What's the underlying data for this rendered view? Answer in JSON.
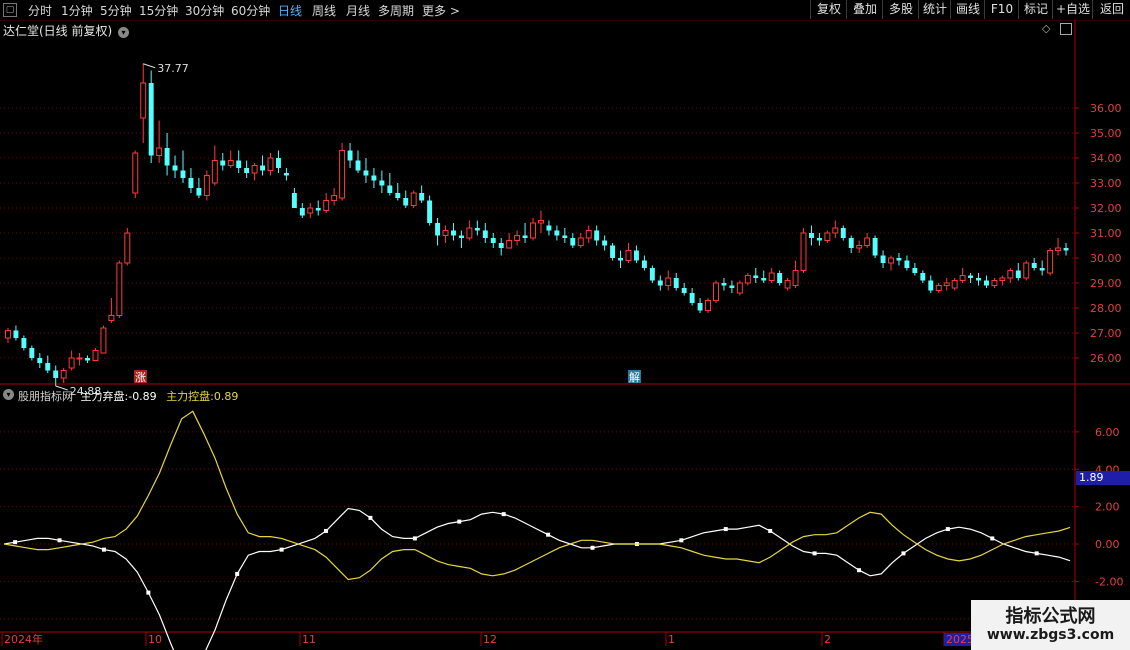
{
  "toolbar": {
    "periods": [
      "分时",
      "1分钟",
      "5分钟",
      "15分钟",
      "30分钟",
      "60分钟",
      "日线",
      "周线",
      "月线",
      "多周期",
      "更多 >"
    ],
    "active_period": "日线",
    "buttons": [
      "复权",
      "叠加",
      "多股",
      "统计",
      "画线",
      "F10",
      "标记",
      "+自选",
      "返回"
    ]
  },
  "stock": {
    "title": "达仁堂(日线 前复权)"
  },
  "indicator": {
    "name": "股朋指标网",
    "line1_label": "主力弃盘:",
    "line1_value": "-0.89",
    "line2_label": "主力控盘:",
    "line2_value": "0.89",
    "current_marker": "1.89"
  },
  "watermark": {
    "line1": "指标公式网",
    "line2": "www.zbgs3.com"
  },
  "colors": {
    "up": "#ff3a3a",
    "down": "#54ffff",
    "qipan": "#ffffff",
    "kongpan": "#e5d640",
    "grid": "#7a0000",
    "axis": "#b00000"
  },
  "chart_data": [
    {
      "type": "candlestick",
      "title": "达仁堂(日线 前复权)",
      "ylim": [
        25.0,
        38.8
      ],
      "y_ticks": [
        "36.00",
        "35.00",
        "34.00",
        "33.00",
        "32.00",
        "31.00",
        "30.00",
        "29.00",
        "28.00",
        "27.00",
        "26.00"
      ],
      "annotations": {
        "high": "37.77",
        "low": "24.88"
      },
      "markers": [
        "涨",
        "解"
      ],
      "ohlc": [
        [
          26.8,
          27.2,
          26.6,
          27.1
        ],
        [
          27.1,
          27.3,
          26.7,
          26.8
        ],
        [
          26.8,
          26.9,
          26.3,
          26.4
        ],
        [
          26.4,
          26.5,
          25.9,
          26.0
        ],
        [
          26.0,
          26.2,
          25.6,
          25.8
        ],
        [
          25.8,
          26.1,
          25.4,
          25.5
        ],
        [
          25.5,
          25.7,
          24.88,
          25.2
        ],
        [
          25.2,
          25.6,
          25.0,
          25.5
        ],
        [
          25.6,
          26.3,
          25.5,
          26.0
        ],
        [
          26.0,
          26.2,
          25.7,
          26.0
        ],
        [
          26.0,
          26.1,
          25.8,
          25.9
        ],
        [
          25.9,
          26.4,
          25.9,
          26.3
        ],
        [
          26.2,
          27.3,
          26.2,
          27.2
        ],
        [
          27.5,
          28.4,
          27.4,
          27.7
        ],
        [
          27.7,
          29.9,
          27.6,
          29.8
        ],
        [
          29.8,
          31.2,
          29.7,
          31.0
        ],
        [
          32.6,
          34.3,
          32.4,
          34.2
        ],
        [
          35.6,
          37.77,
          34.6,
          37.0
        ],
        [
          37.0,
          37.5,
          33.8,
          34.1
        ],
        [
          34.1,
          35.5,
          33.8,
          34.4
        ],
        [
          34.4,
          35.0,
          33.3,
          33.7
        ],
        [
          33.7,
          34.1,
          33.2,
          33.5
        ],
        [
          33.5,
          34.3,
          33.0,
          33.2
        ],
        [
          33.2,
          33.6,
          32.6,
          32.8
        ],
        [
          32.8,
          33.2,
          32.4,
          32.5
        ],
        [
          32.5,
          33.5,
          32.3,
          33.3
        ],
        [
          33.0,
          34.5,
          32.9,
          33.9
        ],
        [
          33.9,
          34.2,
          33.5,
          33.7
        ],
        [
          33.7,
          34.3,
          33.6,
          33.9
        ],
        [
          33.9,
          34.3,
          33.4,
          33.6
        ],
        [
          33.6,
          33.9,
          33.2,
          33.4
        ],
        [
          33.4,
          33.8,
          33.1,
          33.7
        ],
        [
          33.7,
          34.1,
          33.3,
          33.5
        ],
        [
          33.5,
          34.2,
          33.3,
          34.0
        ],
        [
          34.0,
          34.3,
          33.4,
          33.6
        ],
        [
          33.4,
          33.6,
          33.1,
          33.3
        ],
        [
          32.6,
          32.8,
          32.0,
          32.0
        ],
        [
          32.0,
          32.2,
          31.6,
          31.7
        ],
        [
          31.8,
          32.2,
          31.6,
          32.0
        ],
        [
          32.0,
          32.3,
          31.7,
          31.9
        ],
        [
          31.9,
          32.6,
          31.8,
          32.3
        ],
        [
          32.3,
          32.8,
          32.1,
          32.5
        ],
        [
          32.4,
          34.6,
          32.3,
          34.3
        ],
        [
          34.3,
          34.6,
          33.6,
          33.9
        ],
        [
          33.9,
          34.3,
          33.4,
          33.5
        ],
        [
          33.5,
          34.0,
          33.0,
          33.3
        ],
        [
          33.3,
          33.6,
          32.8,
          33.1
        ],
        [
          33.1,
          33.5,
          32.6,
          32.9
        ],
        [
          32.9,
          33.4,
          32.5,
          32.6
        ],
        [
          32.6,
          33.0,
          32.3,
          32.4
        ],
        [
          32.4,
          32.7,
          32.0,
          32.1
        ],
        [
          32.1,
          32.7,
          32.0,
          32.6
        ],
        [
          32.6,
          32.9,
          32.2,
          32.3
        ],
        [
          32.3,
          32.5,
          31.3,
          31.4
        ],
        [
          31.4,
          31.6,
          30.5,
          30.9
        ],
        [
          30.9,
          31.3,
          30.6,
          31.1
        ],
        [
          31.1,
          31.4,
          30.7,
          30.9
        ],
        [
          30.9,
          31.1,
          30.4,
          30.8
        ],
        [
          30.8,
          31.5,
          30.7,
          31.2
        ],
        [
          31.2,
          31.5,
          30.9,
          31.1
        ],
        [
          31.1,
          31.4,
          30.6,
          30.8
        ],
        [
          30.8,
          31.0,
          30.4,
          30.6
        ],
        [
          30.6,
          30.8,
          30.1,
          30.4
        ],
        [
          30.4,
          31.0,
          30.4,
          30.7
        ],
        [
          30.7,
          31.1,
          30.5,
          30.9
        ],
        [
          30.9,
          31.4,
          30.6,
          30.8
        ],
        [
          30.8,
          31.6,
          30.7,
          31.4
        ],
        [
          31.4,
          31.9,
          31.0,
          31.5
        ],
        [
          31.3,
          31.5,
          30.9,
          31.1
        ],
        [
          31.1,
          31.3,
          30.7,
          30.9
        ],
        [
          30.9,
          31.2,
          30.6,
          30.8
        ],
        [
          30.8,
          31.0,
          30.4,
          30.5
        ],
        [
          30.5,
          31.0,
          30.4,
          30.8
        ],
        [
          30.8,
          31.3,
          30.6,
          31.1
        ],
        [
          31.1,
          31.3,
          30.5,
          30.7
        ],
        [
          30.7,
          30.9,
          30.3,
          30.5
        ],
        [
          30.5,
          30.6,
          29.9,
          30.0
        ],
        [
          30.0,
          30.3,
          29.6,
          29.9
        ],
        [
          29.9,
          30.6,
          29.8,
          30.3
        ],
        [
          30.3,
          30.5,
          29.8,
          29.9
        ],
        [
          29.9,
          30.1,
          29.5,
          29.6
        ],
        [
          29.6,
          29.7,
          29.0,
          29.1
        ],
        [
          29.1,
          29.3,
          28.7,
          28.9
        ],
        [
          28.9,
          29.5,
          28.7,
          29.2
        ],
        [
          29.2,
          29.4,
          28.7,
          28.8
        ],
        [
          28.8,
          29.0,
          28.5,
          28.6
        ],
        [
          28.6,
          28.8,
          28.1,
          28.2
        ],
        [
          28.2,
          28.4,
          27.8,
          27.9
        ],
        [
          27.9,
          28.4,
          27.8,
          28.3
        ],
        [
          28.3,
          29.1,
          28.2,
          29.0
        ],
        [
          29.0,
          29.2,
          28.7,
          28.9
        ],
        [
          28.9,
          29.1,
          28.6,
          28.8
        ],
        [
          28.6,
          29.1,
          28.5,
          29.0
        ],
        [
          29.0,
          29.4,
          28.9,
          29.3
        ],
        [
          29.3,
          29.6,
          29.0,
          29.2
        ],
        [
          29.2,
          29.5,
          29.0,
          29.1
        ],
        [
          29.1,
          29.6,
          29.0,
          29.4
        ],
        [
          29.4,
          29.5,
          28.9,
          29.0
        ],
        [
          28.8,
          29.2,
          28.7,
          29.1
        ],
        [
          28.9,
          29.9,
          28.8,
          29.5
        ],
        [
          29.5,
          31.2,
          29.4,
          31.0
        ],
        [
          31.0,
          31.3,
          30.5,
          30.8
        ],
        [
          30.8,
          31.0,
          30.5,
          30.7
        ],
        [
          30.7,
          31.1,
          30.6,
          31.0
        ],
        [
          31.0,
          31.5,
          30.8,
          31.2
        ],
        [
          31.2,
          31.3,
          30.7,
          30.8
        ],
        [
          30.8,
          30.9,
          30.2,
          30.4
        ],
        [
          30.4,
          30.7,
          30.2,
          30.5
        ],
        [
          30.5,
          31.0,
          30.4,
          30.8
        ],
        [
          30.8,
          30.9,
          30.0,
          30.1
        ],
        [
          30.1,
          30.3,
          29.6,
          29.8
        ],
        [
          29.8,
          30.1,
          29.5,
          30.0
        ],
        [
          30.0,
          30.2,
          29.7,
          29.9
        ],
        [
          29.9,
          30.1,
          29.5,
          29.6
        ],
        [
          29.6,
          29.8,
          29.3,
          29.4
        ],
        [
          29.4,
          29.5,
          29.0,
          29.1
        ],
        [
          29.1,
          29.3,
          28.6,
          28.7
        ],
        [
          28.7,
          29.0,
          28.6,
          28.9
        ],
        [
          28.9,
          29.2,
          28.7,
          29.0
        ],
        [
          28.8,
          29.2,
          28.7,
          29.1
        ],
        [
          29.1,
          29.6,
          29.0,
          29.3
        ],
        [
          29.3,
          29.4,
          29.0,
          29.2
        ],
        [
          29.2,
          29.4,
          28.9,
          29.1
        ],
        [
          29.1,
          29.3,
          28.8,
          28.9
        ],
        [
          28.9,
          29.2,
          28.8,
          29.1
        ],
        [
          29.1,
          29.3,
          28.9,
          29.2
        ],
        [
          29.2,
          29.6,
          29.0,
          29.5
        ],
        [
          29.5,
          29.8,
          29.1,
          29.2
        ],
        [
          29.2,
          29.9,
          29.1,
          29.8
        ],
        [
          29.8,
          30.0,
          29.5,
          29.6
        ],
        [
          29.6,
          29.9,
          29.3,
          29.5
        ],
        [
          29.4,
          30.4,
          29.3,
          30.3
        ],
        [
          30.3,
          30.8,
          30.1,
          30.4
        ],
        [
          30.4,
          30.6,
          30.1,
          30.3
        ]
      ]
    },
    {
      "type": "line",
      "title": "股朋指标网",
      "ylim": [
        -4.6,
        7.6
      ],
      "y_ticks": [
        "6.00",
        "4.00",
        "2.00",
        "0.00",
        "-2.00",
        "-4.00"
      ],
      "x_labels": [
        "2024年",
        "10",
        "11",
        "12",
        "1",
        "2",
        "2025"
      ],
      "series": [
        {
          "name": "主力弃盘",
          "color": "#ffffff",
          "values": [
            0.0,
            0.1,
            0.2,
            0.3,
            0.3,
            0.2,
            0.1,
            0.0,
            -0.1,
            -0.3,
            -0.4,
            -0.8,
            -1.5,
            -2.6,
            -3.8,
            -5.3,
            -6.7,
            -7.1,
            -5.9,
            -4.6,
            -3.0,
            -1.6,
            -0.6,
            -0.4,
            -0.4,
            -0.3,
            -0.1,
            0.1,
            0.3,
            0.7,
            1.3,
            1.9,
            1.8,
            1.4,
            0.8,
            0.4,
            0.3,
            0.3,
            0.6,
            0.9,
            1.1,
            1.2,
            1.3,
            1.6,
            1.7,
            1.6,
            1.4,
            1.1,
            0.8,
            0.5,
            0.2,
            0.0,
            -0.2,
            -0.2,
            -0.1,
            0.0,
            0.0,
            0.0,
            0.0,
            0.0,
            0.1,
            0.2,
            0.4,
            0.6,
            0.7,
            0.8,
            0.8,
            0.9,
            1.0,
            0.7,
            0.3,
            -0.1,
            -0.4,
            -0.5,
            -0.5,
            -0.6,
            -1.0,
            -1.4,
            -1.7,
            -1.6,
            -1.0,
            -0.5,
            -0.1,
            0.3,
            0.6,
            0.8,
            0.9,
            0.8,
            0.6,
            0.3,
            0.0,
            -0.2,
            -0.4,
            -0.5,
            -0.6,
            -0.7,
            -0.89
          ]
        },
        {
          "name": "主力控盘",
          "color": "#e5d640",
          "values": [
            0.0,
            -0.1,
            -0.2,
            -0.3,
            -0.3,
            -0.2,
            -0.1,
            0.0,
            0.1,
            0.3,
            0.4,
            0.8,
            1.5,
            2.6,
            3.8,
            5.3,
            6.7,
            7.1,
            5.9,
            4.6,
            3.0,
            1.6,
            0.6,
            0.4,
            0.4,
            0.3,
            0.1,
            -0.1,
            -0.3,
            -0.7,
            -1.3,
            -1.9,
            -1.8,
            -1.4,
            -0.8,
            -0.4,
            -0.3,
            -0.3,
            -0.6,
            -0.9,
            -1.1,
            -1.2,
            -1.3,
            -1.6,
            -1.7,
            -1.6,
            -1.4,
            -1.1,
            -0.8,
            -0.5,
            -0.2,
            0.0,
            0.2,
            0.2,
            0.1,
            0.0,
            0.0,
            0.0,
            0.0,
            0.0,
            -0.1,
            -0.2,
            -0.4,
            -0.6,
            -0.7,
            -0.8,
            -0.8,
            -0.9,
            -1.0,
            -0.7,
            -0.3,
            0.1,
            0.4,
            0.5,
            0.5,
            0.6,
            1.0,
            1.4,
            1.7,
            1.6,
            1.0,
            0.5,
            0.1,
            -0.3,
            -0.6,
            -0.8,
            -0.9,
            -0.8,
            -0.6,
            -0.3,
            0.0,
            0.2,
            0.4,
            0.5,
            0.6,
            0.7,
            0.89
          ]
        }
      ]
    }
  ]
}
